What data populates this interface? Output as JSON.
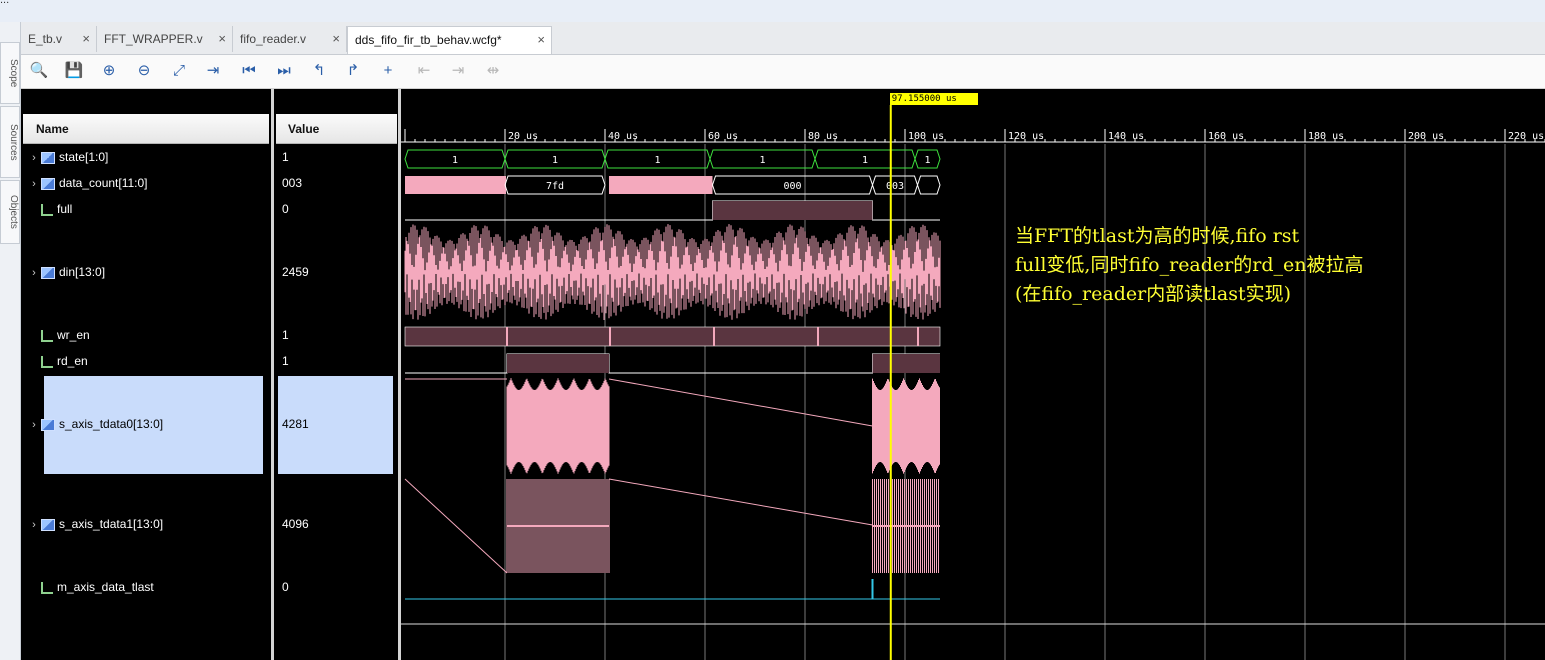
{
  "window": {
    "partial_title": "..."
  },
  "side_tabs": [
    "Scope",
    "Sources",
    "Objects"
  ],
  "tabs": [
    {
      "label": "E_tb.v",
      "active": false
    },
    {
      "label": "FFT_WRAPPER.v",
      "active": false
    },
    {
      "label": "fifo_reader.v",
      "active": false
    },
    {
      "label": "dds_fifo_fir_tb_behav.wcfg*",
      "active": true
    }
  ],
  "tab_close_glyph": "×",
  "toolbar": [
    {
      "name": "search-icon",
      "glyph": "🔍",
      "enabled": true
    },
    {
      "name": "save-icon",
      "glyph": "💾",
      "enabled": true
    },
    {
      "name": "zoom-in-icon",
      "glyph": "⊕",
      "enabled": true
    },
    {
      "name": "zoom-out-icon",
      "glyph": "⊖",
      "enabled": true
    },
    {
      "name": "zoom-fit-icon",
      "glyph": "⤢",
      "enabled": true
    },
    {
      "name": "go-to-cursor-icon",
      "glyph": "⇥",
      "enabled": true
    },
    {
      "name": "go-to-start-icon",
      "glyph": "⏮",
      "enabled": true
    },
    {
      "name": "go-to-end-icon",
      "glyph": "⏭",
      "enabled": true
    },
    {
      "name": "previous-transition-icon",
      "glyph": "↰",
      "enabled": true
    },
    {
      "name": "next-transition-icon",
      "glyph": "↱",
      "enabled": true
    },
    {
      "name": "add-marker-icon",
      "glyph": "+",
      "enabled": true
    },
    {
      "name": "previous-marker-icon",
      "glyph": "⇤",
      "enabled": false
    },
    {
      "name": "next-marker-icon",
      "glyph": "⇥",
      "enabled": false
    },
    {
      "name": "swap-cursors-icon",
      "glyph": "⇹",
      "enabled": false
    }
  ],
  "columns": {
    "name": "Name",
    "value": "Value"
  },
  "signals": [
    {
      "name": "state[1:0]",
      "value": "1",
      "kind": "bus",
      "expandable": true
    },
    {
      "name": "data_count[11:0]",
      "value": "003",
      "kind": "bus",
      "expandable": true
    },
    {
      "name": "full",
      "value": "0",
      "kind": "bit",
      "expandable": false
    },
    {
      "name": "din[13:0]",
      "value": "2459",
      "kind": "bus",
      "expandable": true
    },
    {
      "name": "wr_en",
      "value": "1",
      "kind": "bit",
      "expandable": false
    },
    {
      "name": "rd_en",
      "value": "1",
      "kind": "bit",
      "expandable": false
    },
    {
      "name": "s_axis_tdata0[13:0]",
      "value": "4281",
      "kind": "bus",
      "expandable": true,
      "selected": true
    },
    {
      "name": "s_axis_tdata1[13:0]",
      "value": "4096",
      "kind": "bus",
      "expandable": true
    },
    {
      "name": "m_axis_data_tlast",
      "value": "0",
      "kind": "bit",
      "expandable": false
    }
  ],
  "time_axis": {
    "labels": [
      "20 us",
      "40 us",
      "60 us",
      "80 us",
      "100 us",
      "120 us",
      "140 us",
      "160 us",
      "180 us",
      "200 us",
      "220 us"
    ],
    "cursor_label": "97.155000 us"
  },
  "waveform_values": {
    "state": [
      "1",
      "1",
      "1",
      "1",
      "1",
      "1"
    ],
    "data_count": [
      "7fd",
      "000",
      "003"
    ]
  },
  "annotation": [
    "当FFT的tlast为高的时候,fifo rst",
    "full变低,同时fifo_reader的rd_en被拉高",
    "(在fifo_reader内部读tlast实现)"
  ],
  "colors": {
    "wave_pink": "#f4a9bd",
    "bus_green": "#3ee03e",
    "cursor": "#ffff00",
    "tlast": "#33c8e8",
    "bit_fill": "#5a3540"
  }
}
